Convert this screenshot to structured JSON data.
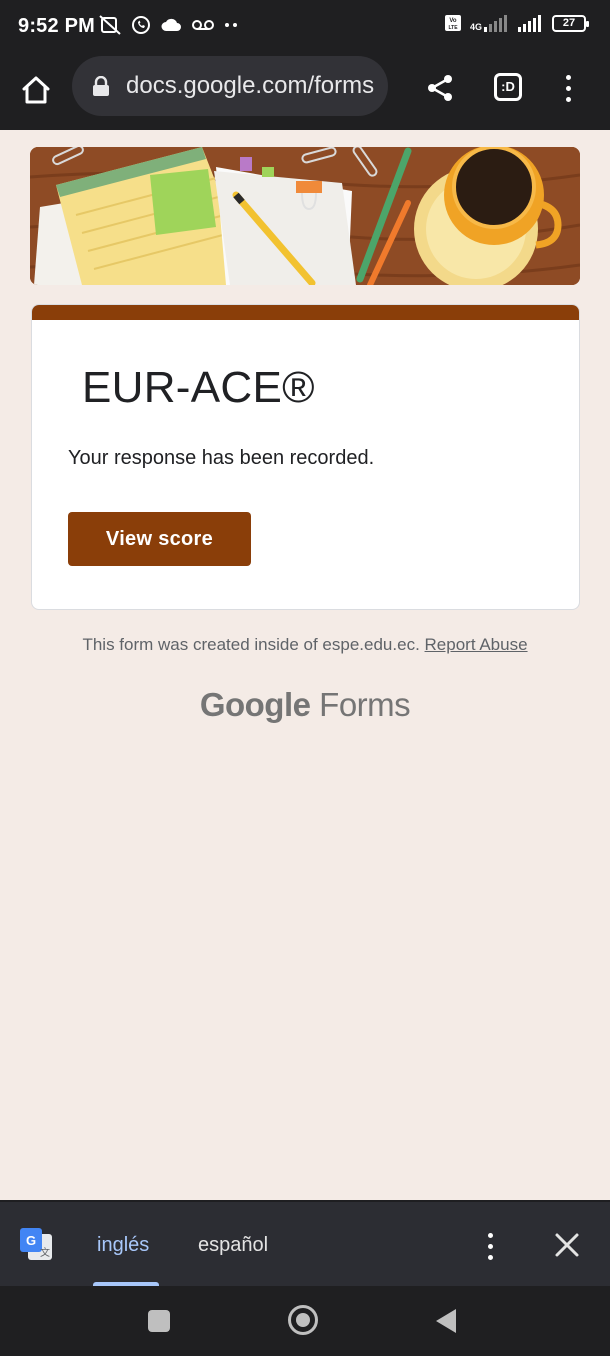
{
  "status_bar": {
    "time": "9:52 PM",
    "left_icons": [
      "mute-vibrate-icon",
      "whatsapp-icon",
      "cloud-icon",
      "voicemail-icon",
      "more-notifications-icon"
    ],
    "network_labels": [
      "Vo LTE",
      "4G"
    ],
    "battery": "27"
  },
  "browser": {
    "url": "docs.google.com/forms",
    "tab_label": ":D",
    "icons": [
      "home-icon",
      "lock-icon",
      "share-icon",
      "tab-switcher-icon",
      "more-vert-icon"
    ]
  },
  "form": {
    "title": "EUR-ACE®",
    "message": "Your response has been recorded.",
    "view_score_label": "View score",
    "accent_color": "#8a3e09"
  },
  "footer": {
    "note": "This form was created inside of espe.edu.ec.",
    "report_label": "Report Abuse",
    "brand_google": "Google",
    "brand_forms": "Forms"
  },
  "translate_bar": {
    "active_language": "inglés",
    "other_language": "español"
  },
  "navigation": {
    "buttons": [
      "recent-apps",
      "home",
      "back"
    ]
  }
}
